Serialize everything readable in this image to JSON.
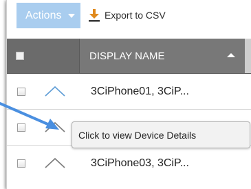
{
  "toolbar": {
    "actions_label": "Actions",
    "export_label": "Export to CSV",
    "export_icon": "download-icon"
  },
  "table": {
    "column_header": "DISPLAY NAME",
    "sort": "ascending",
    "rows": [
      {
        "name": "3CiPhone01, 3CiP...",
        "chevron": "up",
        "chevron_color": "#5b9bd5"
      },
      {
        "name": "",
        "chevron": "up",
        "chevron_color": "#7a7a7a"
      },
      {
        "name": "3CiPhone03, 3CiP...",
        "chevron": "up",
        "chevron_color": "#7a7a7a"
      }
    ]
  },
  "tooltip": {
    "text": "Click to view Device Details"
  },
  "colors": {
    "accent": "#a9cdef",
    "header_bg": "#787878",
    "annotation_arrow": "#4a8fe0"
  }
}
